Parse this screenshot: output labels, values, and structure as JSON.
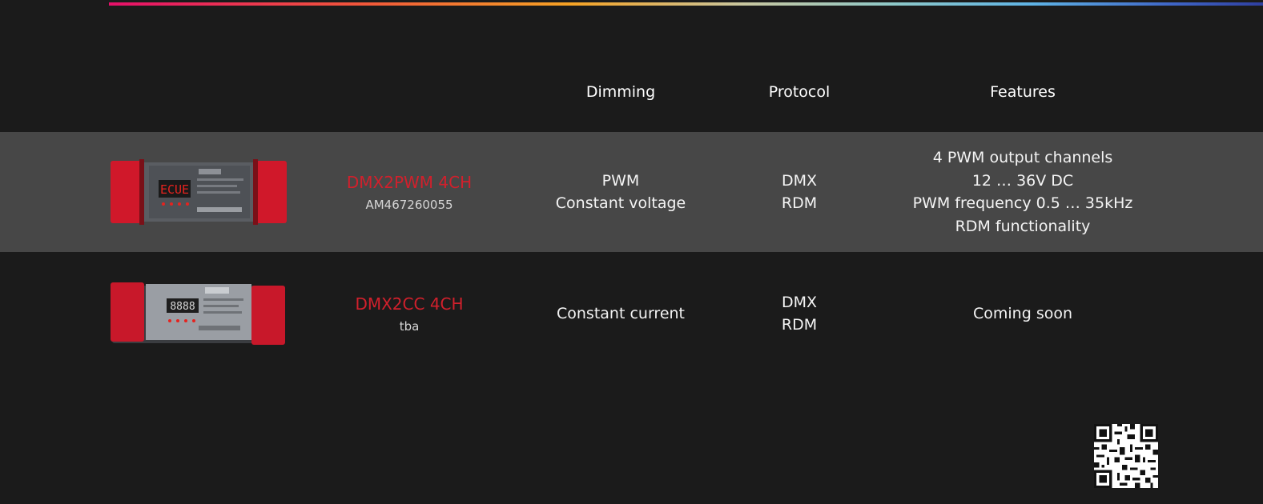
{
  "header": {
    "dimming": "Dimming",
    "protocol": "Protocol",
    "features": "Features"
  },
  "products": [
    {
      "name": "DMX2PWM 4CH",
      "code": "AM467260055",
      "display": "ECUE",
      "dimming": [
        "PWM",
        "Constant voltage"
      ],
      "protocol": [
        "DMX",
        "RDM"
      ],
      "features": [
        "4 PWM output channels",
        "12 … 36V DC",
        "PWM frequency 0.5 … 35kHz",
        "RDM functionality"
      ]
    },
    {
      "name": "DMX2CC 4CH",
      "code": "tba",
      "display": "8888",
      "dimming": [
        "Constant current"
      ],
      "protocol": [
        "DMX",
        "RDM"
      ],
      "features": [
        "Coming soon"
      ]
    }
  ],
  "colors": {
    "background": "#1b1b1b",
    "row_highlight": "#474747",
    "product_name": "#d1202c",
    "device_red": "#d0182a"
  },
  "icons": [
    "qr-code-icon"
  ]
}
